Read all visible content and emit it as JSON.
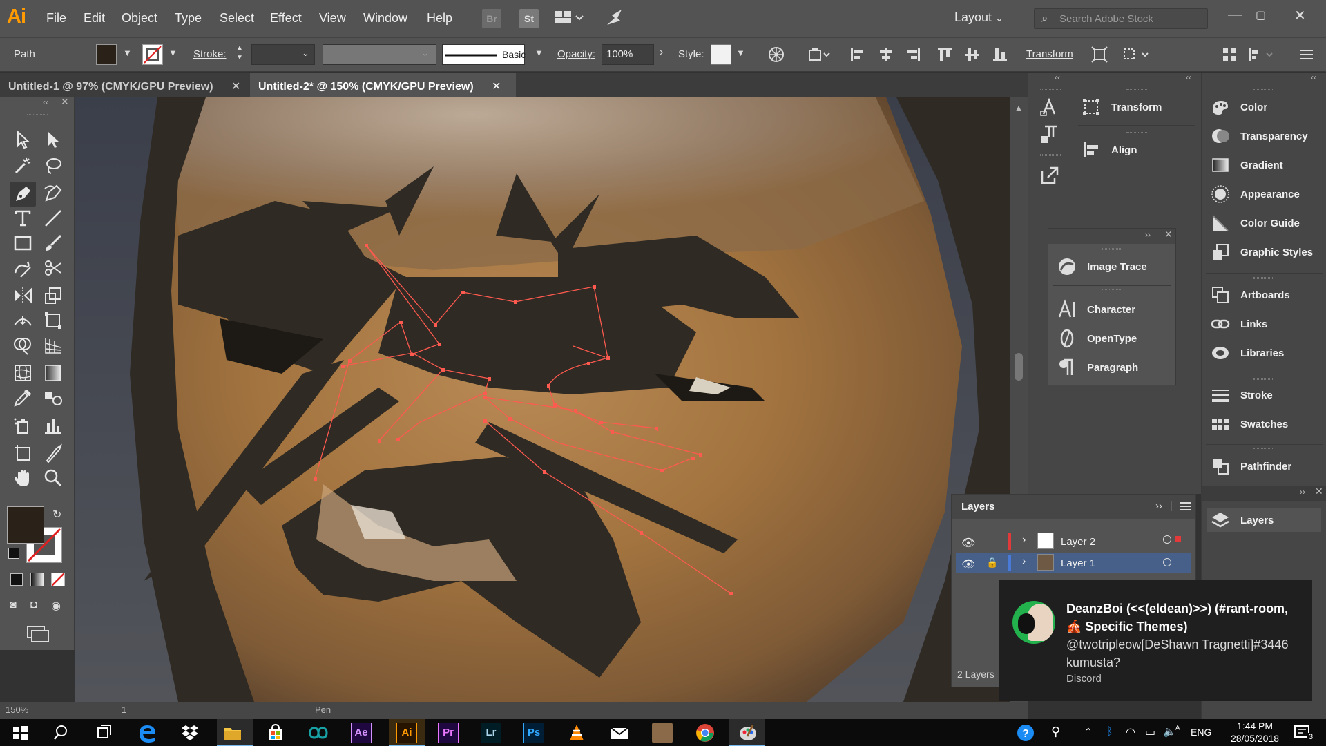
{
  "app": {
    "logo": "Ai",
    "menus": [
      "File",
      "Edit",
      "Object",
      "Type",
      "Select",
      "Effect",
      "View",
      "Window",
      "Help"
    ],
    "bridge_label": "Br",
    "stock_label": "St",
    "workspace": "Layout",
    "search_placeholder": "Search Adobe Stock"
  },
  "control": {
    "selection_type": "Path",
    "stroke_label": "Stroke:",
    "brush_label": "Basic",
    "opacity_label": "Opacity:",
    "opacity_value": "100%",
    "style_label": "Style:",
    "transform_label": "Transform",
    "fill_color": "#2a2218"
  },
  "tabs": [
    {
      "label": "Untitled-1 @ 97% (CMYK/GPU Preview)",
      "active": false
    },
    {
      "label": "Untitled-2* @ 150% (CMYK/GPU Preview)",
      "active": true
    }
  ],
  "panels": {
    "dock2": [
      {
        "label": "Transform",
        "icon": "transform-icon"
      },
      {
        "label": "Align",
        "icon": "align-icon"
      }
    ],
    "float": [
      {
        "label": "Image Trace",
        "icon": "image-trace-icon"
      },
      {
        "label": "Character",
        "icon": "character-icon"
      },
      {
        "label": "OpenType",
        "icon": "opentype-icon"
      },
      {
        "label": "Paragraph",
        "icon": "paragraph-icon"
      }
    ],
    "dock3": [
      {
        "label": "Color",
        "icon": "color-icon"
      },
      {
        "label": "Transparency",
        "icon": "transparency-icon"
      },
      {
        "label": "Gradient",
        "icon": "gradient-icon"
      },
      {
        "label": "Appearance",
        "icon": "appearance-icon"
      },
      {
        "label": "Color Guide",
        "icon": "color-guide-icon"
      },
      {
        "label": "Graphic Styles",
        "icon": "graphic-styles-icon"
      },
      {
        "label": "Artboards",
        "icon": "artboards-icon"
      },
      {
        "label": "Links",
        "icon": "links-icon"
      },
      {
        "label": "Libraries",
        "icon": "libraries-icon"
      },
      {
        "label": "Stroke",
        "icon": "stroke-icon"
      },
      {
        "label": "Swatches",
        "icon": "swatches-icon"
      },
      {
        "label": "Pathfinder",
        "icon": "pathfinder-icon"
      }
    ],
    "layers_tab": "Layers"
  },
  "layers": {
    "title": "Layers",
    "rows": [
      {
        "name": "Layer 2",
        "color": "#e23a3a",
        "locked": false,
        "selected": false
      },
      {
        "name": "Layer 1",
        "color": "#4a7ad8",
        "locked": true,
        "selected": true
      }
    ],
    "count": "2 Layers"
  },
  "statusbar": {
    "zoom": "150%",
    "artboard": "1",
    "tool": "Pen"
  },
  "notification": {
    "title": "DeanzBoi (<<(eldean)>>) (#rant-room, 🎪 Specific Themes)",
    "body": "@twotripleow[DeShawn Tragnetti]#3446  kumusta?",
    "app": "Discord"
  },
  "taskbar": {
    "language": "ENG",
    "time": "1:44 PM",
    "date": "28/05/2018",
    "notifications": "3",
    "apps": [
      "windows-start-icon",
      "search-icon",
      "task-view-icon",
      "edge-icon",
      "dropbox-icon",
      "file-explorer-icon",
      "store-icon",
      "arduino-icon",
      "after-effects-icon",
      "illustrator-icon",
      "premiere-icon",
      "lightroom-icon",
      "photoshop-icon",
      "vlc-icon",
      "mail-icon",
      "photo-icon",
      "chrome-icon",
      "paint-icon"
    ],
    "app_labels": {
      "ae": "Ae",
      "ai": "Ai",
      "pr": "Pr",
      "lr": "Lr",
      "ps": "Ps"
    }
  }
}
